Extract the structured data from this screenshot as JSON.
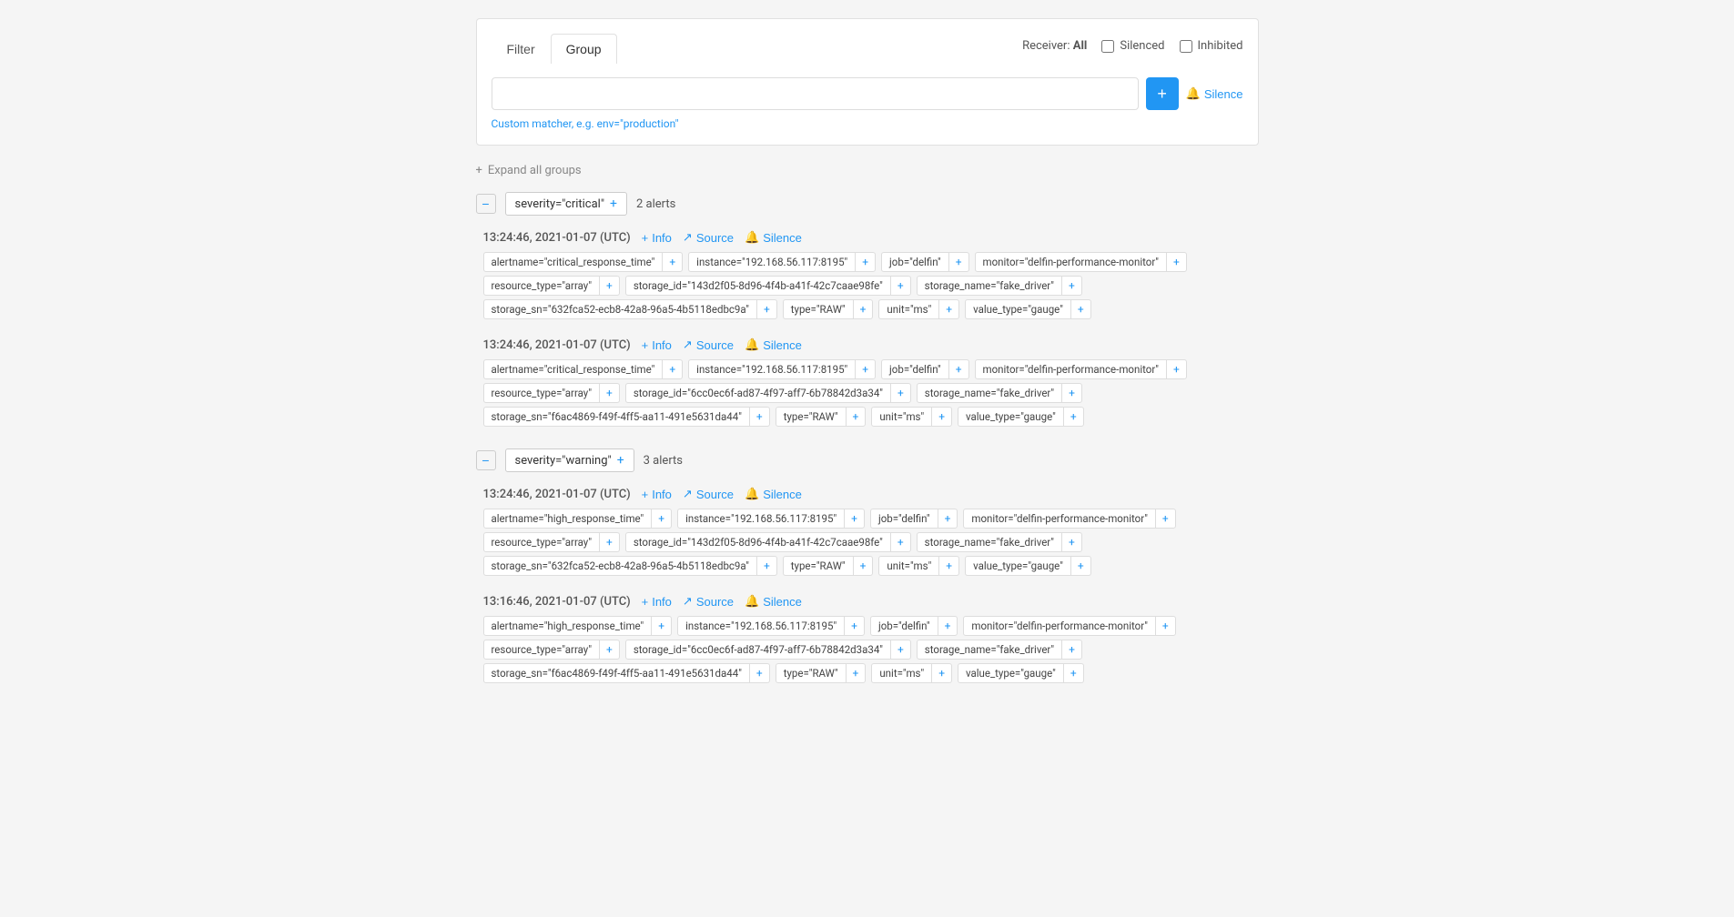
{
  "tabs": [
    {
      "label": "Filter",
      "active": false
    },
    {
      "label": "Group",
      "active": true
    }
  ],
  "receiver": {
    "label": "Receiver:",
    "value": "All"
  },
  "checkboxes": [
    {
      "label": "Silenced",
      "checked": false
    },
    {
      "label": "Inhibited",
      "checked": false
    }
  ],
  "filter": {
    "placeholder": "",
    "hint": "Custom matcher, e.g.",
    "hint_example": "env=\"production\""
  },
  "buttons": {
    "add": "+",
    "silence_top": "Silence",
    "expand_all": "Expand all groups"
  },
  "groups": [
    {
      "id": "critical",
      "severity_tag": "severity=\"critical\"",
      "count": "2 alerts",
      "alerts": [
        {
          "time": "13:24:46, 2021-01-07 (UTC)",
          "actions": [
            "Info",
            "Source",
            "Silence"
          ],
          "tag_rows": [
            [
              {
                "text": "alertname=\"critical_response_time\""
              },
              {
                "text": "instance=\"192.168.56.117:8195\""
              },
              {
                "text": "job=\"delfin\""
              },
              {
                "text": "monitor=\"delfin-performance-monitor\""
              }
            ],
            [
              {
                "text": "resource_type=\"array\""
              },
              {
                "text": "storage_id=\"143d2f05-8d96-4f4b-a41f-42c7caae98fe\""
              },
              {
                "text": "storage_name=\"fake_driver\""
              }
            ],
            [
              {
                "text": "storage_sn=\"632fca52-ecb8-42a8-96a5-4b5118edbc9a\""
              },
              {
                "text": "type=\"RAW\""
              },
              {
                "text": "unit=\"ms\""
              },
              {
                "text": "value_type=\"gauge\""
              }
            ]
          ]
        },
        {
          "time": "13:24:46, 2021-01-07 (UTC)",
          "actions": [
            "Info",
            "Source",
            "Silence"
          ],
          "tag_rows": [
            [
              {
                "text": "alertname=\"critical_response_time\""
              },
              {
                "text": "instance=\"192.168.56.117:8195\""
              },
              {
                "text": "job=\"delfin\""
              },
              {
                "text": "monitor=\"delfin-performance-monitor\""
              }
            ],
            [
              {
                "text": "resource_type=\"array\""
              },
              {
                "text": "storage_id=\"6cc0ec6f-ad87-4f97-aff7-6b78842d3a34\""
              },
              {
                "text": "storage_name=\"fake_driver\""
              }
            ],
            [
              {
                "text": "storage_sn=\"f6ac4869-f49f-4ff5-aa11-491e5631da44\""
              },
              {
                "text": "type=\"RAW\""
              },
              {
                "text": "unit=\"ms\""
              },
              {
                "text": "value_type=\"gauge\""
              }
            ]
          ]
        }
      ]
    },
    {
      "id": "warning",
      "severity_tag": "severity=\"warning\"",
      "count": "3 alerts",
      "alerts": [
        {
          "time": "13:24:46, 2021-01-07 (UTC)",
          "actions": [
            "Info",
            "Source",
            "Silence"
          ],
          "tag_rows": [
            [
              {
                "text": "alertname=\"high_response_time\""
              },
              {
                "text": "instance=\"192.168.56.117:8195\""
              },
              {
                "text": "job=\"delfin\""
              },
              {
                "text": "monitor=\"delfin-performance-monitor\""
              }
            ],
            [
              {
                "text": "resource_type=\"array\""
              },
              {
                "text": "storage_id=\"143d2f05-8d96-4f4b-a41f-42c7caae98fe\""
              },
              {
                "text": "storage_name=\"fake_driver\""
              }
            ],
            [
              {
                "text": "storage_sn=\"632fca52-ecb8-42a8-96a5-4b5118edbc9a\""
              },
              {
                "text": "type=\"RAW\""
              },
              {
                "text": "unit=\"ms\""
              },
              {
                "text": "value_type=\"gauge\""
              }
            ]
          ]
        },
        {
          "time": "13:16:46, 2021-01-07 (UTC)",
          "actions": [
            "Info",
            "Source",
            "Silence"
          ],
          "tag_rows": [
            [
              {
                "text": "alertname=\"high_response_time\""
              },
              {
                "text": "instance=\"192.168.56.117:8195\""
              },
              {
                "text": "job=\"delfin\""
              },
              {
                "text": "monitor=\"delfin-performance-monitor\""
              }
            ],
            [
              {
                "text": "resource_type=\"array\""
              },
              {
                "text": "storage_id=\"6cc0ec6f-ad87-4f97-aff7-6b78842d3a34\""
              },
              {
                "text": "storage_name=\"fake_driver\""
              }
            ],
            [
              {
                "text": "storage_sn=\"f6ac4869-f49f-4ff5-aa11-491e5631da44\""
              },
              {
                "text": "type=\"RAW\""
              },
              {
                "text": "unit=\"ms\""
              },
              {
                "text": "value_type=\"gauge\""
              }
            ]
          ]
        }
      ]
    }
  ]
}
